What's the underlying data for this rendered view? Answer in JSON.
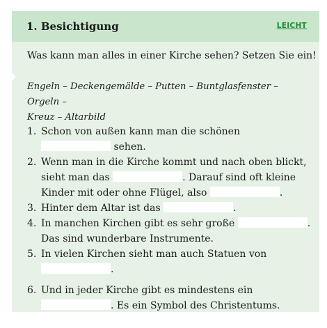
{
  "exercise": {
    "title": "1. Besichtigung",
    "level": "LEICHT",
    "instruction": "Was kann man alles in einer Kirche sehen? Setzen Sie ein!",
    "words_line1": "Engeln – Deckengemälde – Putten – Buntglasfenster – Orgeln –",
    "words_line2": "Kreuz – Altarbild",
    "colors": {
      "header": "#c9e6cc",
      "card": "#e6f2e6",
      "badge": "#1f8a3a"
    }
  },
  "items": [
    {
      "num": "1.",
      "a": "Schon von außen kann man die schönen",
      "b": "sehen."
    },
    {
      "num": "2.",
      "a": "Wenn man in die Kirche kommt und nach oben blickt,",
      "b": "sieht man das",
      "c": ". Darauf sind oft kleine",
      "d": "Kinder mit oder ohne Flügel, also",
      "e": "."
    },
    {
      "num": "3.",
      "a": "Hinter dem Altar ist das",
      "b": "."
    },
    {
      "num": "4.",
      "a": "In manchen Kirchen gibt es sehr große",
      "b": ".",
      "c": "Das sind wunderbare Instrumente."
    },
    {
      "num": "5.",
      "a": "In vielen Kirchen sieht man auch Statuen von",
      "b": "."
    },
    {
      "num": "6.",
      "a": "Und in jeder Kirche gibt es mindestens ein",
      "b": ". Es ein Symbol des Christentums."
    }
  ]
}
